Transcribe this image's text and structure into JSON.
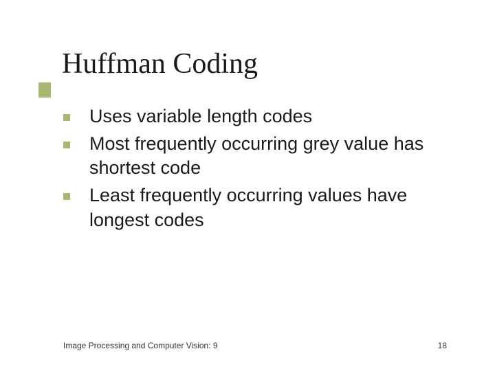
{
  "slide": {
    "title": "Huffman Coding",
    "bullets": [
      "Uses variable length codes",
      "Most frequently occurring grey value has shortest code",
      "Least frequently occurring values have longest codes"
    ],
    "footer_left": "Image Processing and Computer Vision: 9",
    "page_number": "18"
  },
  "colors": {
    "accent": "#a6b872"
  }
}
